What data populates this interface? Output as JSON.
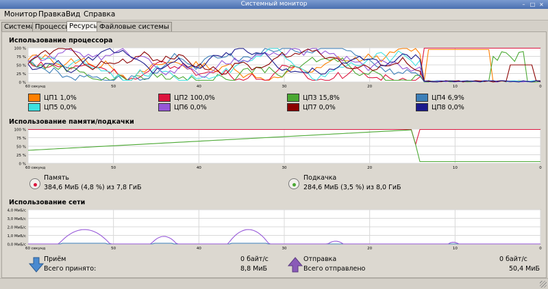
{
  "window": {
    "title": "Системный монитор"
  },
  "menu": [
    "Монитор",
    "Правка",
    "Вид",
    "Справка"
  ],
  "tabs": [
    {
      "label": "Система",
      "active": false
    },
    {
      "label": "Процессы",
      "active": false
    },
    {
      "label": "Ресурсы",
      "active": true
    },
    {
      "label": "Файловые системы",
      "active": false
    }
  ],
  "cpu": {
    "title": "Использование процессора",
    "y_ticks": [
      "100 %",
      "75 %",
      "50 %",
      "25 %",
      "0 %"
    ],
    "x_ticks": [
      "60 секунд",
      "50",
      "40",
      "30",
      "20",
      "10",
      "0"
    ],
    "legend": [
      {
        "label": "ЦП1 1,0%",
        "color": "#ff7f00"
      },
      {
        "label": "ЦП2 100,0%",
        "color": "#dc143c"
      },
      {
        "label": "ЦП3 15,8%",
        "color": "#4aa832"
      },
      {
        "label": "ЦП4 6,9%",
        "color": "#3c7fb8"
      },
      {
        "label": "ЦП5 0,0%",
        "color": "#3de0e0"
      },
      {
        "label": "ЦП6 0,0%",
        "color": "#9657d8"
      },
      {
        "label": "ЦП7 0,0%",
        "color": "#8b0000"
      },
      {
        "label": "ЦП8 0,0%",
        "color": "#1a1a8c"
      }
    ]
  },
  "memory": {
    "title": "Использование памяти/подкачки",
    "y_ticks": [
      "100 %",
      "75 %",
      "50 %",
      "25 %",
      "0 %"
    ],
    "x_ticks": [
      "60 секунд",
      "50",
      "40",
      "30",
      "20",
      "10",
      "0"
    ],
    "mem_label": "Память",
    "mem_value": "384,6 МиБ (4,8 %) из 7,8 ГиБ",
    "mem_color": "#dc143c",
    "swap_label": "Подкачка",
    "swap_value": "284,6 МиБ (3,5 %) из 8,0 ГиБ",
    "swap_color": "#4aa832"
  },
  "network": {
    "title": "Использование сети",
    "y_ticks": [
      "4,0 МиБ/с",
      "3,0 МиБ/с",
      "2,0 МиБ/с",
      "1,0 МиБ/с",
      "0,0 МиБ/с"
    ],
    "x_ticks": [
      "60 секунд",
      "50",
      "40",
      "30",
      "20",
      "10",
      "0"
    ],
    "rx_label": "Приём",
    "rx_rate": "0 байт/с",
    "rx_total_label": "Всего принято:",
    "rx_total": "8,8 МиБ",
    "rx_color": "#3c7fb8",
    "tx_label": "Отправка",
    "tx_rate": "0 байт/с",
    "tx_total_label": "Всего отправлено",
    "tx_total": "50,4 МиБ",
    "tx_color": "#9657d8"
  }
}
